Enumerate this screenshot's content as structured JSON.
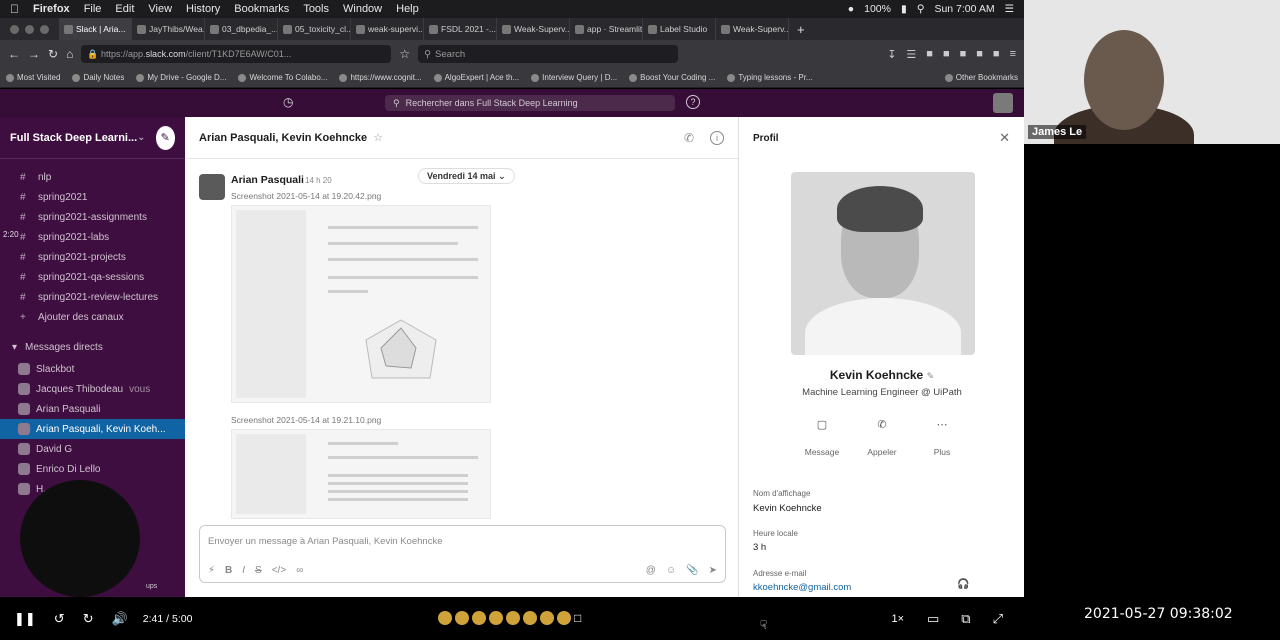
{
  "menubar": {
    "app": "Firefox",
    "menus": [
      "File",
      "Edit",
      "View",
      "History",
      "Bookmarks",
      "Tools",
      "Window",
      "Help"
    ],
    "battery": "100%",
    "clock": "Sun 7:00 AM"
  },
  "tabs": [
    "Slack | Aria...",
    "JayThibs/Wea...",
    "03_dbpedia_...",
    "05_toxicity_cl...",
    "weak-supervi...",
    "FSDL 2021 -...",
    "Weak-Superv...",
    "app · Streamlit",
    "Label Studio",
    "Weak-Superv..."
  ],
  "nav": {
    "url_prefix": "https://app.",
    "url_domain": "slack.com",
    "url_rest": "/client/T1KD7E6AW/C01...",
    "search_placeholder": "Search"
  },
  "bookmarks": {
    "items": [
      "Most Visited",
      "Daily Notes",
      "My Drive - Google D...",
      "Welcome To Colabo...",
      "https://www.cognit...",
      "AlgoExpert | Ace th...",
      "Interview Query | D...",
      "Boost Your Coding ...",
      "Typing lessons - Pr..."
    ],
    "other": "Other Bookmarks"
  },
  "slacktop": {
    "search": "Rechercher dans Full Stack Deep Learning"
  },
  "sidebar": {
    "workspace": "Full Stack Deep Learni...",
    "channels": [
      "nlp",
      "spring2021",
      "spring2021-assignments",
      "spring2021-labs",
      "spring2021-projects",
      "spring2021-qa-sessions",
      "spring2021-review-lectures"
    ],
    "add_channels": "Ajouter des canaux",
    "dm_section": "Messages directs",
    "dms": [
      {
        "name": "Slackbot",
        "suffix": ""
      },
      {
        "name": "Jacques Thibodeau",
        "suffix": "vous"
      },
      {
        "name": "Arian Pasquali",
        "suffix": ""
      },
      {
        "name": "Arian Pasquali, Kevin Koeh...",
        "suffix": ""
      },
      {
        "name": "David G",
        "suffix": ""
      },
      {
        "name": "Enrico Di Lello",
        "suffix": ""
      },
      {
        "name": "H...",
        "suffix": ""
      }
    ],
    "overlay_time": "2:20",
    "cam_name": "ups"
  },
  "conversation": {
    "title": "Arian Pasquali, Kevin Koehncke",
    "date": "Vendredi 14 mai",
    "author": "Arian Pasquali",
    "time": "14 h 20",
    "file1": "Screenshot 2021-05-14 at 19.20.42.png",
    "file2": "Screenshot 2021-05-14 at 19.21.10.png",
    "composer_placeholder": "Envoyer un message à Arian Pasquali, Kevin Koehncke"
  },
  "profile": {
    "header": "Profil",
    "name": "Kevin Koehncke",
    "title": "Machine Learning Engineer @ UiPath",
    "actions": [
      "Message",
      "Appeler",
      "Plus"
    ],
    "display_name_label": "Nom d'affichage",
    "display_name": "Kevin Koehncke",
    "local_time_label": "Heure locale",
    "local_time": "3 h",
    "email_label": "Adresse e-mail",
    "email": "kkoehncke@gmail.com"
  },
  "video": {
    "participant": "James Le",
    "elapsed": "2:41 / 5:00",
    "speed": "1×",
    "timestamp": "2021-05-27  09:38:02"
  }
}
